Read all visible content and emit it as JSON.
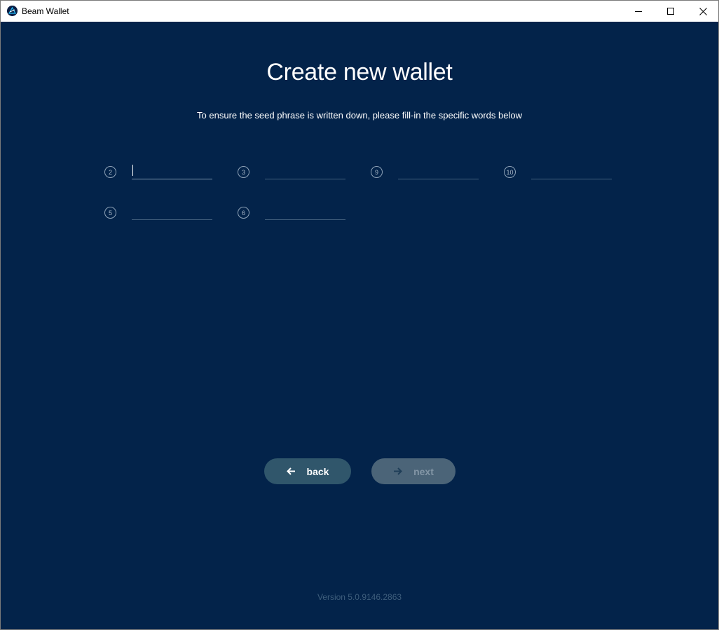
{
  "window": {
    "title": "Beam Wallet",
    "controls": [
      "minimize",
      "maximize",
      "close"
    ]
  },
  "page": {
    "title": "Create new wallet",
    "subtitle": "To ensure the seed phrase is written down, please fill-in the specific words below"
  },
  "seed_words": [
    {
      "number": "2",
      "value": "",
      "focused": true
    },
    {
      "number": "3",
      "value": "",
      "focused": false
    },
    {
      "number": "9",
      "value": "",
      "focused": false
    },
    {
      "number": "10",
      "value": "",
      "focused": false
    },
    {
      "number": "5",
      "value": "",
      "focused": false
    },
    {
      "number": "6",
      "value": "",
      "focused": false
    }
  ],
  "buttons": {
    "back": {
      "label": "back",
      "icon": "arrow-left-icon",
      "enabled": true
    },
    "next": {
      "label": "next",
      "icon": "arrow-right-icon",
      "enabled": false
    }
  },
  "footer": {
    "version": "Version 5.0.9146.2863"
  },
  "colors": {
    "background": "#03234a",
    "back_button": "#30566b",
    "next_button_disabled": "#4b6478",
    "version_text": "#3e5e7c"
  }
}
